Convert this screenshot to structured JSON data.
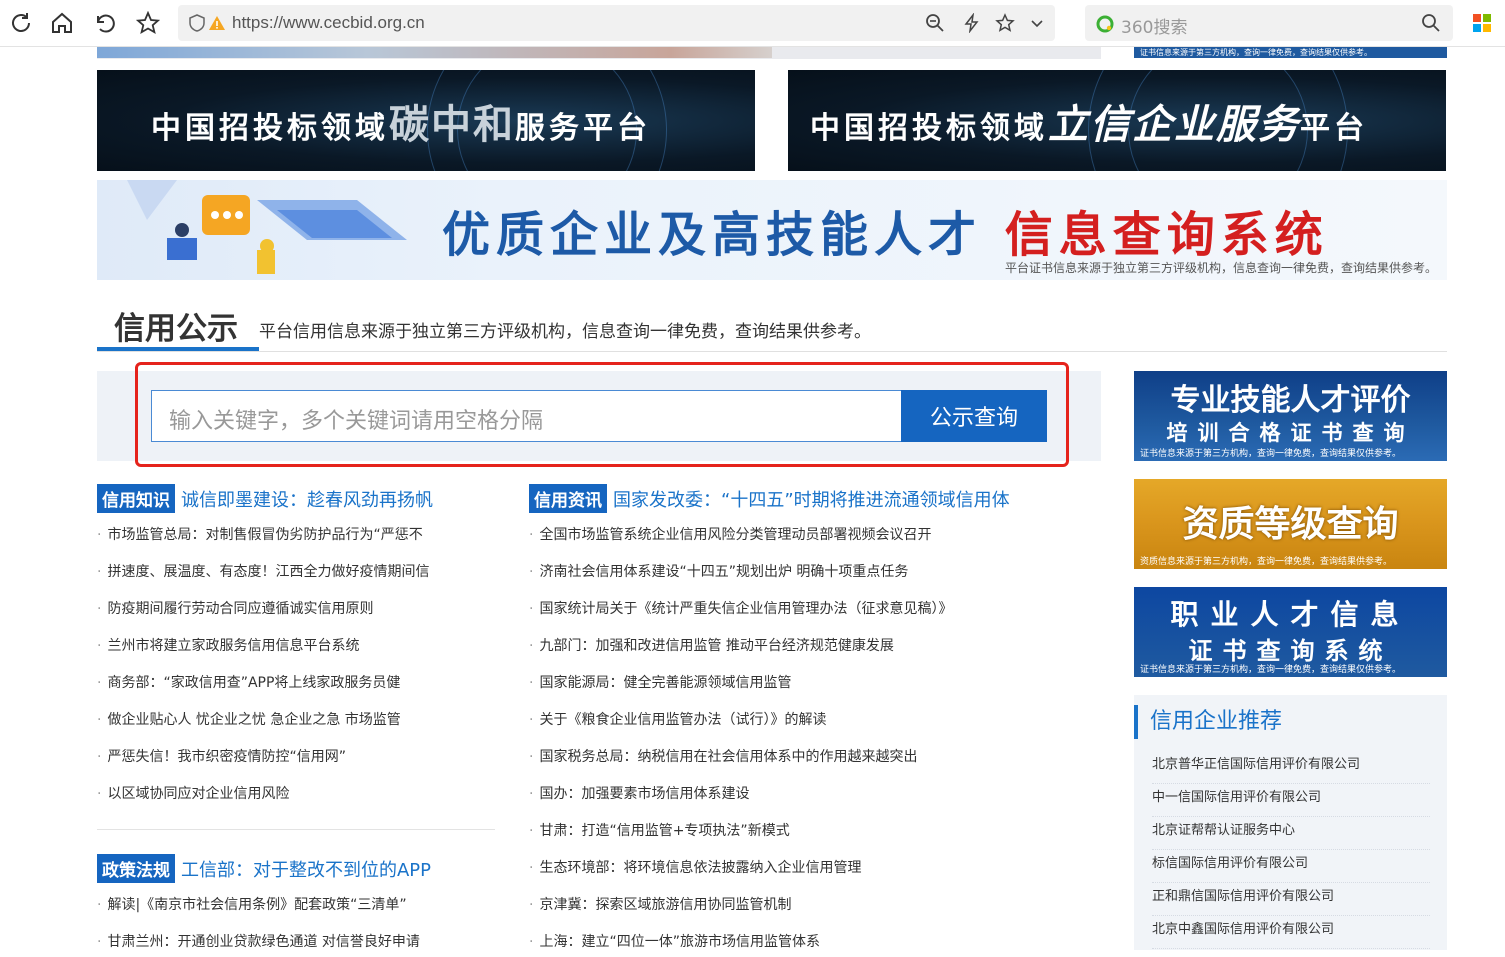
{
  "browser": {
    "url": "https://www.cecbid.org.cn",
    "search_placeholder": "360搜索"
  },
  "top_right_strip_text": "证书信息来源于第三方机构，查询一律免费，查询结果仅供参考。",
  "banners": {
    "carbon": {
      "prefix": "中国招投标领域",
      "highlight": "碳中和",
      "suffix": "服务平台"
    },
    "credit": {
      "prefix": "中国招投标领域",
      "highlight": "立信企业服务",
      "suffix": "平台"
    },
    "talent": {
      "main": "优质企业及高技能人才",
      "red": "信息查询系统",
      "note": "平台证书信息来源于独立第三方评级机构，信息查询一律免费，查询结果供参考。"
    }
  },
  "section": {
    "title": "信用公示",
    "desc": "平台信用信息来源于独立第三方评级机构，信息查询一律免费，查询结果供参考。"
  },
  "search": {
    "placeholder": "输入关键字，多个关键词请用空格分隔",
    "button": "公示查询"
  },
  "knowledge": {
    "tag": "信用知识",
    "headline": "诚信即墨建设：趁春风劲再扬帆",
    "items": [
      "市场监管总局：对制售假冒伪劣防护品行为“严惩不",
      "拼速度、展温度、有态度！江西全力做好疫情期间信",
      "防疫期间履行劳动合同应遵循诚实信用原则",
      "兰州市将建立家政服务信用信息平台系统",
      "商务部：“家政信用查”APP将上线家政服务员健",
      "做企业贴心人 忧企业之忧 急企业之急 市场监管",
      "严惩失信！我市织密疫情防控“信用网”",
      "以区域协同应对企业信用风险"
    ]
  },
  "policy": {
    "tag": "政策法规",
    "headline": "工信部：对于整改不到位的APP",
    "items": [
      "解读|《南京市社会信用条例》配套政策“三清单”",
      "甘肃兰州：开通创业贷款绿色通道 对信誉良好申请"
    ]
  },
  "news": {
    "tag": "信用资讯",
    "headline": "国家发改委：“十四五”时期将推进流通领域信用体",
    "items": [
      "全国市场监管系统企业信用风险分类管理动员部署视频会议召开",
      "济南社会信用体系建设“十四五”规划出炉 明确十项重点任务",
      "国家统计局关于《统计严重失信企业信用管理办法（征求意见稿）》",
      "九部门：加强和改进信用监管 推动平台经济规范健康发展",
      "国家能源局：健全完善能源领域信用监管",
      "关于《粮食企业信用监管办法（试行）》的解读",
      "国家税务总局：纳税信用在社会信用体系中的作用越来越突出",
      "国办：加强要素市场信用体系建设",
      "甘肃：打造“信用监管+专项执法”新模式",
      "生态环境部：将环境信息依法披露纳入企业信用管理",
      "京津冀：探索区域旅游信用协同监管机制",
      "上海：建立“四位一体”旅游市场信用监管体系"
    ]
  },
  "ads": {
    "skill": {
      "line1": "专业技能人才评价",
      "line2": "培训合格证书查询",
      "line3": "证书信息来源于第三方机构，查询一律免费，查询结果仅供参考。"
    },
    "qual": {
      "line1": "资质等级查询",
      "line3": "资质信息来源于第三方机构，查询一律免费，查询结果供参考。"
    },
    "prof": {
      "line1": "职业人才信息",
      "line2": "证书查询系统",
      "line3": "证书信息来源于第三方机构，查询一律免费，查询结果仅供参考。"
    }
  },
  "recommend": {
    "title": "信用企业推荐",
    "items": [
      "北京普华正信国际信用评价有限公司",
      "中一信国际信用评价有限公司",
      "北京证帮帮认证服务中心",
      "标信国际信用评价有限公司",
      "正和鼎信国际信用评价有限公司",
      "北京中鑫国际信用评价有限公司"
    ]
  },
  "colors": {
    "accent": "#1565c0",
    "highlight_frame": "#e5231c"
  }
}
